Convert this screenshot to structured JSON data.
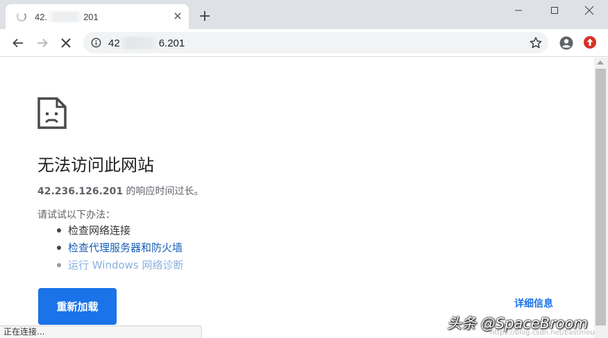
{
  "tab": {
    "title_start": "42.",
    "title_end": "201",
    "close_glyph": "✕"
  },
  "new_tab_glyph": "+",
  "window_controls": [
    "minimize-icon",
    "maximize-icon",
    "close-icon"
  ],
  "address_bar": {
    "url_start": "42",
    "url_end": "6.201"
  },
  "error_page": {
    "heading": "无法访问此网站",
    "host": "42.236.126.201",
    "message_suffix": " 的响应时间过长。",
    "try_label": "请试试以下办法：",
    "suggestions": [
      "检查网络连接",
      "检查代理服务器和防火墙",
      "运行 Windows 网络诊断"
    ],
    "reload_label": "重新加载",
    "details_label": "详细信息"
  },
  "status_bar": "正在连接...",
  "watermark": {
    "main": "头条 @SpaceBroom",
    "sub": "https://blog.csdn.net/Eastmou"
  },
  "colors": {
    "accent": "#1a73e8",
    "tabstrip": "#dee1e6",
    "extension_badge": "#d93025"
  }
}
